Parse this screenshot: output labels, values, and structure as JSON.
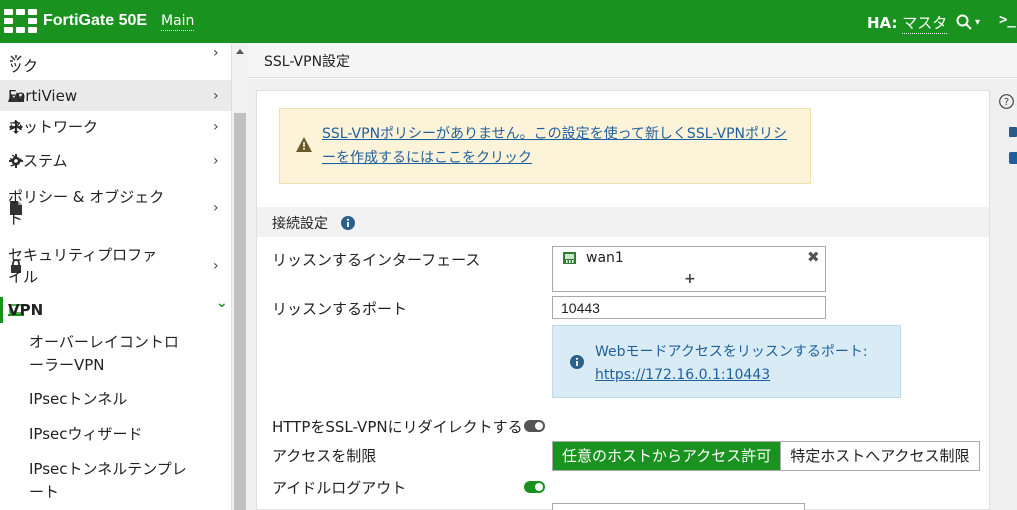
{
  "header": {
    "product": "FortiGate 50E",
    "vdom": "Main",
    "ha_label": "HA:",
    "ha_value": "マスタ",
    "search_caret": "▾",
    "terminal": ">_"
  },
  "sidebar": {
    "items": [
      {
        "label": "ック",
        "icon": "dashboard-icon"
      },
      {
        "label": "FortiView",
        "icon": "chart-icon"
      },
      {
        "label": "ネットワーク",
        "icon": "network-icon"
      },
      {
        "label": "システム",
        "icon": "gear-icon"
      },
      {
        "label": "ポリシー & オブジェクト",
        "icon": "policy-icon"
      },
      {
        "label": "セキュリティプロファイル",
        "icon": "lock-icon"
      },
      {
        "label": "VPN",
        "icon": "laptop-icon"
      }
    ],
    "vpn_sub": [
      {
        "label": "オーバーレイコントローラーVPN"
      },
      {
        "label": "IPsecトンネル"
      },
      {
        "label": "IPsecウィザード"
      },
      {
        "label": "IPsecトンネルテンプレート"
      }
    ],
    "chevron_right": "›",
    "chevron_down": "⌄"
  },
  "breadcrumb": "SSL-VPN設定",
  "warning": {
    "text": "SSL-VPNポリシーがありません。この設定を使って新しくSSL-VPNポリシーを作成するにはここをクリック"
  },
  "section": {
    "title": "接続設定"
  },
  "form": {
    "listen_interface_label": "リッスンするインターフェース",
    "interface_value": "wan1",
    "add_symbol": "+",
    "remove_symbol": "✖",
    "listen_port_label": "リッスンするポート",
    "listen_port_value": "10443",
    "web_mode_text": "Webモードアクセスをリッスンするポート:",
    "web_mode_link": "https://172.16.0.1:10443",
    "redirect_label": "HTTPをSSL-VPNにリダイレクトする",
    "redirect_enabled": false,
    "restrict_access_label": "アクセスを制限",
    "access_options": [
      "任意のホストからアクセス許可",
      "特定ホストへアクセス制限"
    ],
    "access_selected": 0,
    "idle_logout_label": "アイドルログアウト",
    "idle_logout_enabled": true
  },
  "colors": {
    "brand_green": "#1a921f",
    "link_blue": "#1f5f9e",
    "warning_bg": "#fcf3d8",
    "info_bg": "#d9ecf5"
  }
}
